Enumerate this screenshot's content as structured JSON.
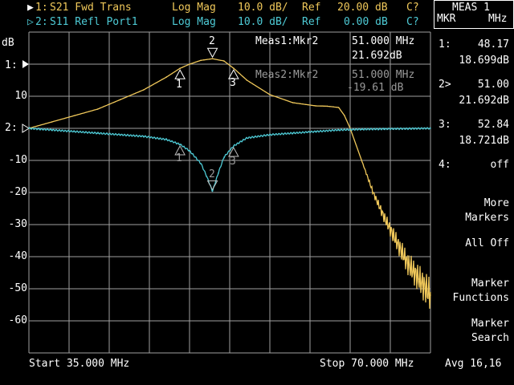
{
  "header": {
    "trace1": {
      "marker": "▶",
      "id": "1:",
      "name": "S21 Fwd Trans",
      "format": "Log Mag",
      "scale": "10.0 dB/",
      "ref_label": "Ref",
      "ref_value": "20.00 dB",
      "flag": "C?"
    },
    "trace2": {
      "marker": "▷",
      "id": "2:",
      "name": "S11 Refl Port1",
      "format": "Log Mag",
      "scale": "10.0 dB/",
      "ref_label": "Ref",
      "ref_value": "0.00 dB",
      "flag": "C?"
    }
  },
  "unit_label": "dB",
  "y_axis": {
    "ticks": [
      "",
      "10",
      "",
      "-10",
      "-20",
      "-30",
      "-40",
      "-50",
      "-60"
    ],
    "ref_markers": [
      "1:",
      "2:"
    ]
  },
  "meas": {
    "meas1_label": "Meas1:Mkr2",
    "meas1_freq": "51.000 MHz",
    "meas1_value": "21.692dB",
    "meas2_label": "Meas2:Mkr2",
    "meas2_freq": "51.000 MHz",
    "meas2_value": "-19.61 dB"
  },
  "trace_marker_labels": [
    "1",
    "2",
    "3"
  ],
  "footer": {
    "start": "Start 35.000 MHz",
    "stop": "Stop 70.000 MHz",
    "avg": "Avg 16,16"
  },
  "side_panel": {
    "title": "MEAS 1",
    "col_left": "MKR",
    "col_right": "MHz",
    "markers": [
      {
        "id": "1:",
        "freq": "48.17",
        "value": "18.699dB"
      },
      {
        "id": "2>",
        "freq": "51.00",
        "value": "21.692dB"
      },
      {
        "id": "3:",
        "freq": "52.84",
        "value": "18.721dB"
      },
      {
        "id": "4:",
        "freq": "off",
        "value": ""
      }
    ],
    "softkeys": [
      {
        "line1": "More",
        "line2": "Markers"
      },
      {
        "line1": "All Off",
        "line2": ""
      },
      {
        "line1": "Marker",
        "line2": "Functions"
      },
      {
        "line1": "Marker",
        "line2": "Search"
      }
    ]
  },
  "colors": {
    "trace1": "#f0c85a",
    "trace2": "#4ecbd6",
    "grid": "#a0a0a0",
    "background": "#000000"
  },
  "chart_data": {
    "type": "line",
    "x_range": [
      35,
      70
    ],
    "x_unit": "MHz",
    "series": [
      {
        "name": "S21 Fwd Trans",
        "unit": "dB",
        "x": [
          35,
          37,
          39,
          41,
          43,
          45,
          47,
          48.17,
          49,
          50,
          51,
          52,
          52.84,
          54,
          56,
          58,
          60,
          61,
          62,
          62.5,
          63,
          64,
          65,
          66,
          67,
          68,
          69,
          70
        ],
        "y": [
          0,
          2,
          4,
          6,
          9,
          12,
          16,
          18.699,
          20,
          21.2,
          21.692,
          21,
          18.721,
          15,
          10.5,
          8,
          7,
          6.9,
          6.5,
          4,
          0,
          -10,
          -20,
          -28,
          -35,
          -42,
          -47,
          -52
        ]
      },
      {
        "name": "S11 Refl Port1",
        "unit": "dB",
        "x": [
          35,
          37,
          39,
          41,
          43,
          45,
          47,
          48.17,
          49,
          50,
          50.5,
          51,
          51.5,
          52,
          52.84,
          54,
          56,
          58,
          60,
          62,
          64,
          66,
          68,
          70
        ],
        "y": [
          0,
          -0.5,
          -1,
          -1.5,
          -2,
          -2.5,
          -3.5,
          -5,
          -7,
          -11,
          -15,
          -19.61,
          -14,
          -9,
          -5.5,
          -3,
          -2,
          -1.5,
          -1,
          -0.5,
          -0.3,
          -0.2,
          -0.1,
          0
        ]
      }
    ]
  }
}
